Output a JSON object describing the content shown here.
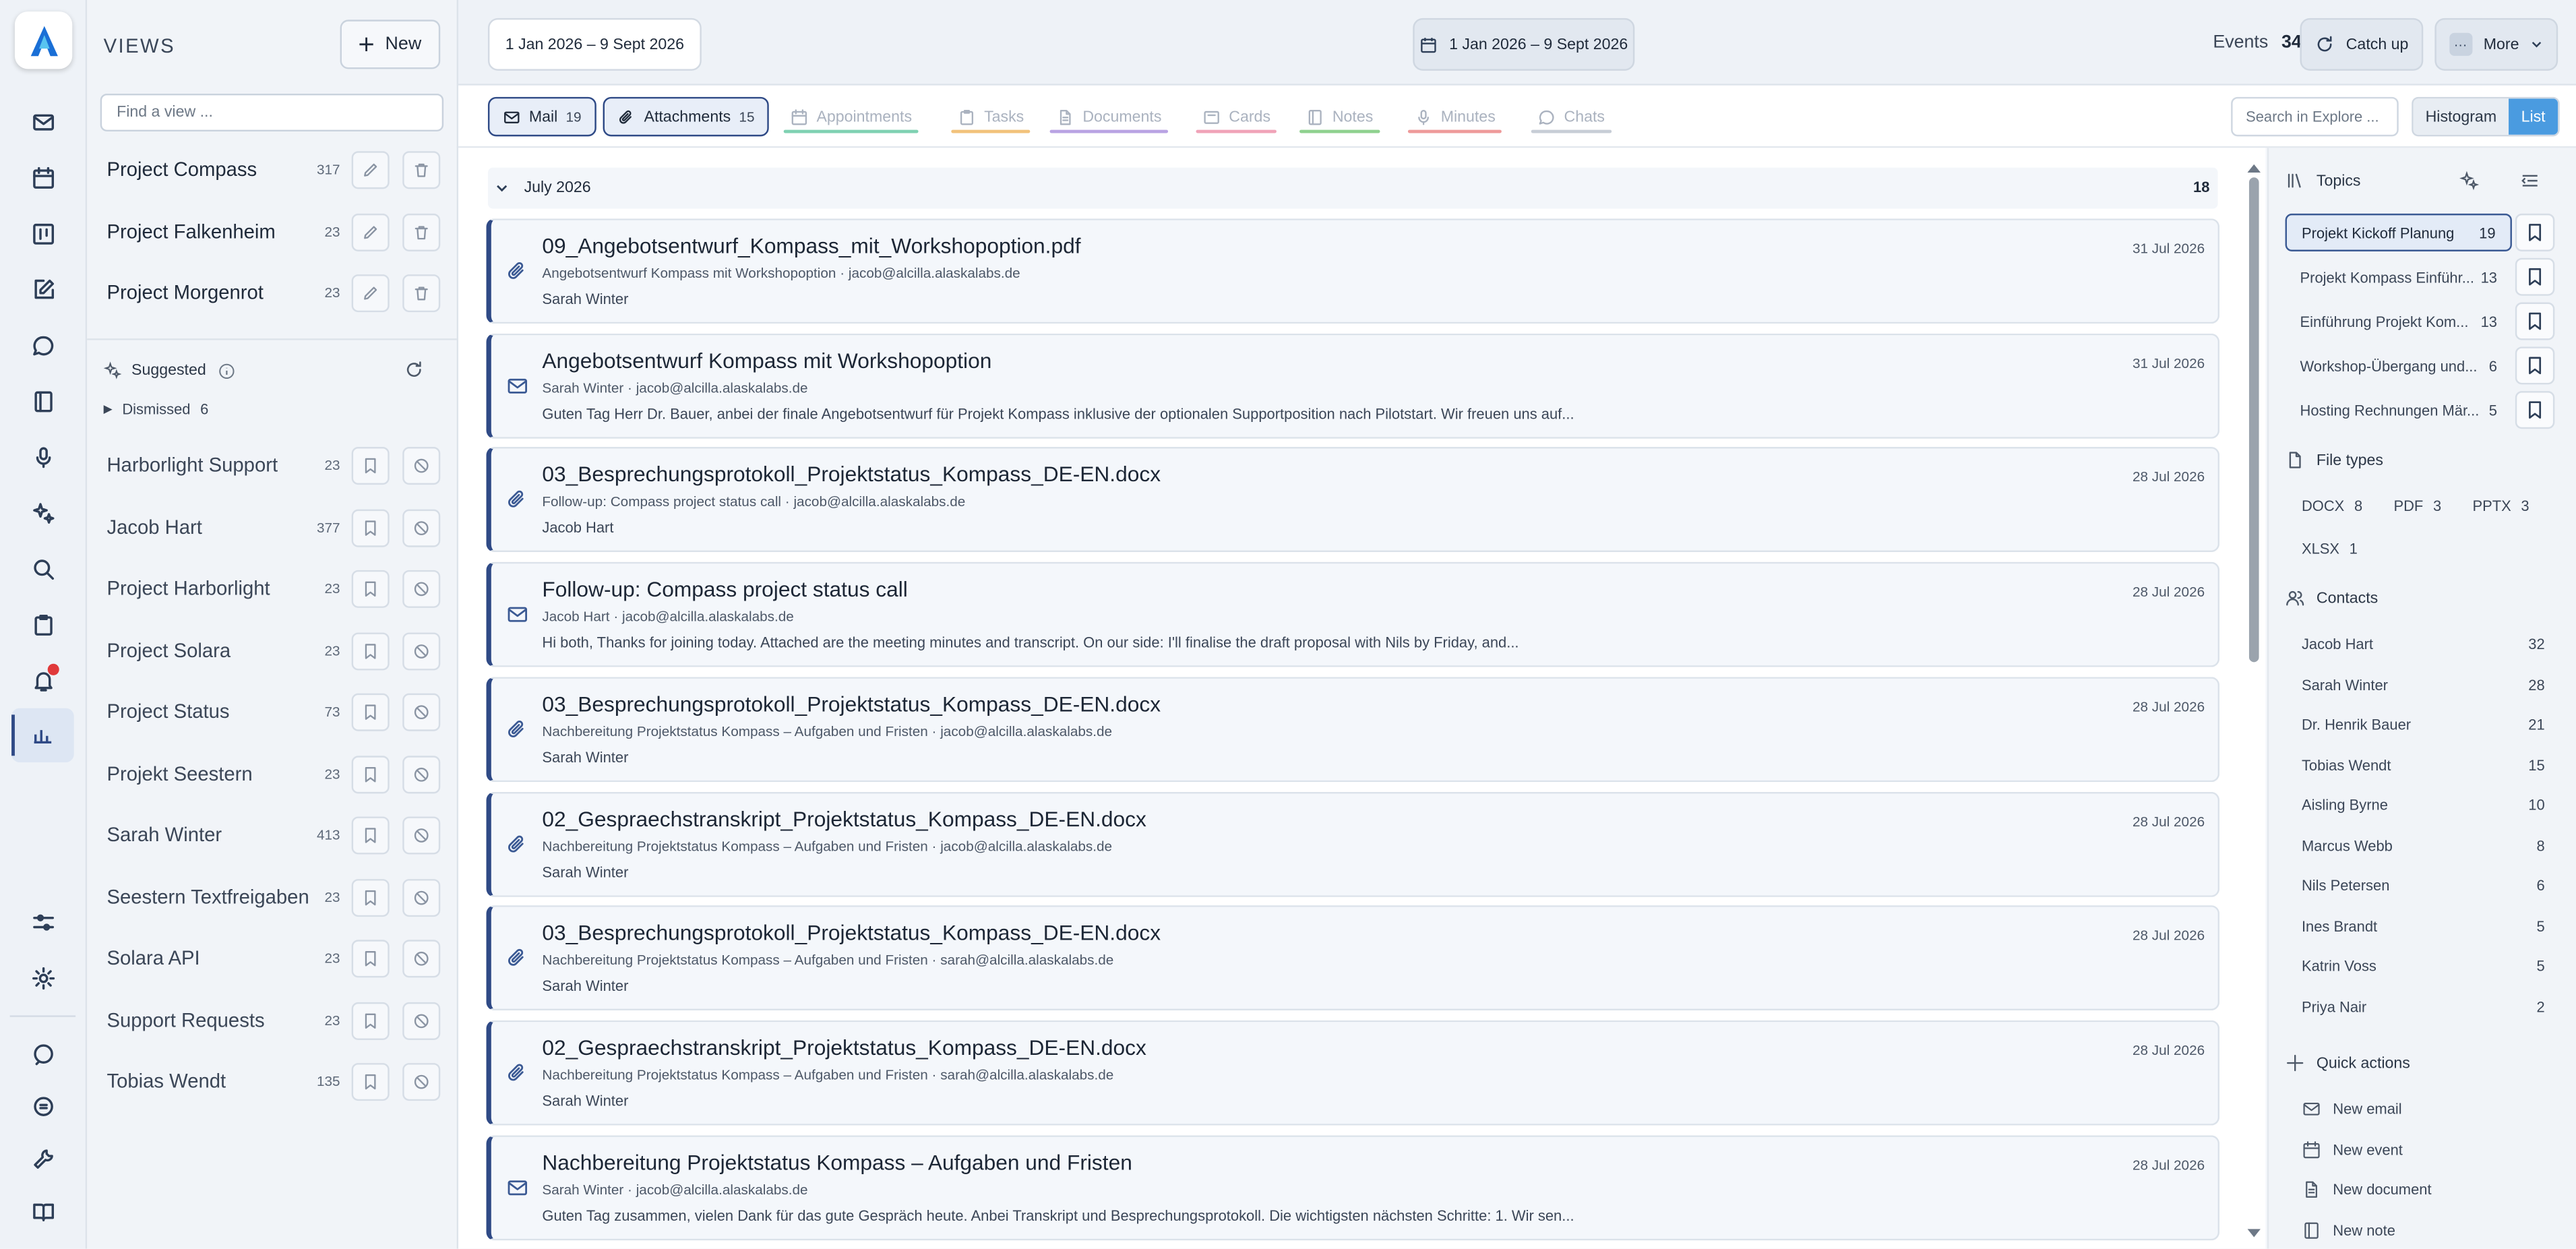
{
  "views": {
    "title": "VIEWS",
    "new_label": "New",
    "find_placeholder": "Find a view ...",
    "saved": [
      {
        "name": "Project Compass",
        "count": "317"
      },
      {
        "name": "Project Falkenheim",
        "count": "23"
      },
      {
        "name": "Project Morgenrot",
        "count": "23"
      }
    ],
    "suggested_label": "Suggested",
    "dismissed_label": "Dismissed",
    "dismissed_count": "6",
    "suggested": [
      {
        "name": "Harborlight Support",
        "count": "23"
      },
      {
        "name": "Jacob Hart",
        "count": "377"
      },
      {
        "name": "Project Harborlight",
        "count": "23"
      },
      {
        "name": "Project Solara",
        "count": "23"
      },
      {
        "name": "Project Status",
        "count": "73"
      },
      {
        "name": "Projekt Seestern",
        "count": "23"
      },
      {
        "name": "Sarah Winter",
        "count": "413"
      },
      {
        "name": "Seestern Textfreigaben",
        "count": "23"
      },
      {
        "name": "Solara API",
        "count": "23"
      },
      {
        "name": "Support Requests",
        "count": "23"
      },
      {
        "name": "Tobias Wendt",
        "count": "135"
      }
    ]
  },
  "topbar": {
    "date_range": "1 Jan 2026 – 9 Sept 2026",
    "date_range_center": "1 Jan 2026 – 9 Sept 2026",
    "events_label": "Events",
    "events_count": "34",
    "catchup_label": "Catch up",
    "more_label": "More"
  },
  "filters": {
    "tabs": [
      {
        "label": "Mail",
        "count": "19",
        "active": true,
        "color": "#2f4a86"
      },
      {
        "label": "Attachments",
        "count": "15",
        "active": true,
        "color": "#2f4a86"
      },
      {
        "label": "Appointments",
        "count": "",
        "active": false,
        "color": "#7fd1b2"
      },
      {
        "label": "Tasks",
        "count": "",
        "active": false,
        "color": "#f2c27b"
      },
      {
        "label": "Documents",
        "count": "",
        "active": false,
        "color": "#b9a3e3"
      },
      {
        "label": "Cards",
        "count": "",
        "active": false,
        "color": "#f0a3b8"
      },
      {
        "label": "Notes",
        "count": "",
        "active": false,
        "color": "#8fd18f"
      },
      {
        "label": "Minutes",
        "count": "",
        "active": false,
        "color": "#ee9a9a"
      },
      {
        "label": "Chats",
        "count": "",
        "active": false,
        "color": "#c7cdd6"
      }
    ],
    "search_placeholder": "Search in Explore ...",
    "histogram_label": "Histogram",
    "list_label": "List"
  },
  "list": {
    "group_label": "July 2026",
    "group_count": "18",
    "items": [
      {
        "kind": "attachment",
        "title": "09_Angebotsentwurf_Kompass_mit_Workshopoption.pdf",
        "sub": "Angebotsentwurf Kompass mit Workshopoption · jacob@alcilla.alaskalabs.de",
        "preview": "Sarah Winter",
        "date": "31 Jul 2026"
      },
      {
        "kind": "mail",
        "title": "Angebotsentwurf Kompass mit Workshopoption",
        "sub": "Sarah Winter · jacob@alcilla.alaskalabs.de",
        "preview": "Guten Tag Herr Dr. Bauer, anbei der finale Angebotsentwurf für Projekt Kompass inklusive der optionalen Supportposition nach Pilotstart. Wir freuen uns auf...",
        "date": "31 Jul 2026"
      },
      {
        "kind": "attachment",
        "title": "03_Besprechungsprotokoll_Projektstatus_Kompass_DE-EN.docx",
        "sub": "Follow-up: Compass project status call · jacob@alcilla.alaskalabs.de",
        "preview": "Jacob Hart",
        "date": "28 Jul 2026"
      },
      {
        "kind": "mail",
        "title": "Follow-up: Compass project status call",
        "sub": "Jacob Hart · jacob@alcilla.alaskalabs.de",
        "preview": "Hi both, Thanks for joining today. Attached are the meeting minutes and transcript. On our side: I'll finalise the draft proposal with Nils by Friday, and...",
        "date": "28 Jul 2026"
      },
      {
        "kind": "attachment",
        "title": "03_Besprechungsprotokoll_Projektstatus_Kompass_DE-EN.docx",
        "sub": "Nachbereitung Projektstatus Kompass – Aufgaben und Fristen · jacob@alcilla.alaskalabs.de",
        "preview": "Sarah Winter",
        "date": "28 Jul 2026"
      },
      {
        "kind": "attachment",
        "title": "02_Gespraechstranskript_Projektstatus_Kompass_DE-EN.docx",
        "sub": "Nachbereitung Projektstatus Kompass – Aufgaben und Fristen · jacob@alcilla.alaskalabs.de",
        "preview": "Sarah Winter",
        "date": "28 Jul 2026"
      },
      {
        "kind": "attachment",
        "title": "03_Besprechungsprotokoll_Projektstatus_Kompass_DE-EN.docx",
        "sub": "Nachbereitung Projektstatus Kompass – Aufgaben und Fristen · sarah@alcilla.alaskalabs.de",
        "preview": "Sarah Winter",
        "date": "28 Jul 2026"
      },
      {
        "kind": "attachment",
        "title": "02_Gespraechstranskript_Projektstatus_Kompass_DE-EN.docx",
        "sub": "Nachbereitung Projektstatus Kompass – Aufgaben und Fristen · sarah@alcilla.alaskalabs.de",
        "preview": "Sarah Winter",
        "date": "28 Jul 2026"
      },
      {
        "kind": "mail",
        "title": "Nachbereitung Projektstatus Kompass – Aufgaben und Fristen",
        "sub": "Sarah Winter · jacob@alcilla.alaskalabs.de",
        "preview": "Guten Tag zusammen, vielen Dank für das gute Gespräch heute. Anbei Transkript und Besprechungsprotokoll. Die wichtigsten nächsten Schritte: 1. Wir sen...",
        "date": "28 Jul 2026"
      }
    ]
  },
  "panel": {
    "topics_label": "Topics",
    "topics": [
      {
        "label": "Projekt Kickoff Planung",
        "count": "19",
        "active": true
      },
      {
        "label": "Projekt Kompass Einführ...",
        "count": "13",
        "active": false
      },
      {
        "label": "Einführung Projekt Kom...",
        "count": "13",
        "active": false
      },
      {
        "label": "Workshop-Übergang und...",
        "count": "6",
        "active": false
      },
      {
        "label": "Hosting Rechnungen Mär...",
        "count": "5",
        "active": false
      }
    ],
    "filetypes_label": "File types",
    "filetypes": [
      {
        "label": "DOCX",
        "count": "8"
      },
      {
        "label": "PDF",
        "count": "3"
      },
      {
        "label": "PPTX",
        "count": "3"
      },
      {
        "label": "XLSX",
        "count": "1"
      }
    ],
    "contacts_label": "Contacts",
    "contacts": [
      {
        "name": "Jacob Hart",
        "count": "32"
      },
      {
        "name": "Sarah Winter",
        "count": "28"
      },
      {
        "name": "Dr. Henrik Bauer",
        "count": "21"
      },
      {
        "name": "Tobias Wendt",
        "count": "15"
      },
      {
        "name": "Aisling Byrne",
        "count": "10"
      },
      {
        "name": "Marcus Webb",
        "count": "8"
      },
      {
        "name": "Nils Petersen",
        "count": "6"
      },
      {
        "name": "Ines Brandt",
        "count": "5"
      },
      {
        "name": "Katrin Voss",
        "count": "5"
      },
      {
        "name": "Priya Nair",
        "count": "2"
      }
    ],
    "quick_label": "Quick actions",
    "quick": [
      {
        "label": "New email",
        "icon": "mail-icon"
      },
      {
        "label": "New event",
        "icon": "calendar-icon"
      },
      {
        "label": "New document",
        "icon": "document-icon"
      },
      {
        "label": "New note",
        "icon": "note-icon"
      }
    ]
  },
  "colors": {
    "accent": "#2f4a86",
    "list_active": "#4a9be0"
  }
}
